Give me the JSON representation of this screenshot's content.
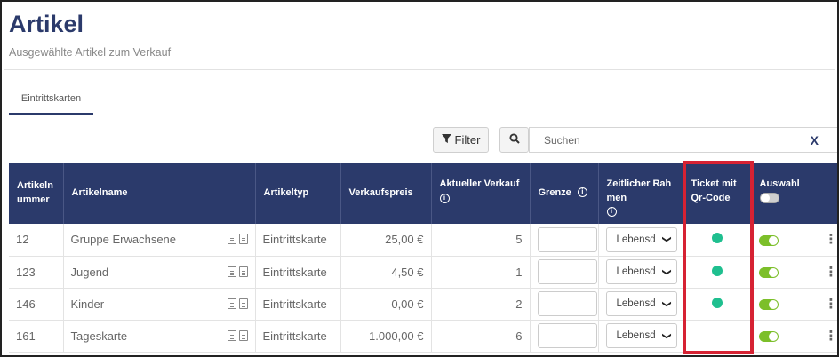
{
  "header": {
    "title": "Artikel",
    "subtitle": "Ausgewählte Artikel zum Verkauf"
  },
  "tabs": [
    {
      "label": "Eintrittskarten",
      "active": true
    }
  ],
  "toolbar": {
    "filter_label": "Filter",
    "search_placeholder": "Suchen",
    "clear_label": "X"
  },
  "table": {
    "columns": [
      {
        "label": "Artikeln ummer"
      },
      {
        "label": "Artikelname"
      },
      {
        "label": "Artikeltyp"
      },
      {
        "label": "Verkaufspreis"
      },
      {
        "label": "Aktueller Verkauf"
      },
      {
        "label": "Grenze"
      },
      {
        "label": "Zeitlicher Rah men"
      },
      {
        "label": "Ticket mit Qr-Code"
      },
      {
        "label": "Auswahl"
      }
    ],
    "rows": [
      {
        "nummer": "12",
        "name": "Gruppe Erwachsene",
        "typ": "Eintrittskarte",
        "preis": "25,00 €",
        "verkauf": "5",
        "grenze": "",
        "rahmen": "Lebensd",
        "qr": true,
        "auswahl": true
      },
      {
        "nummer": "123",
        "name": "Jugend",
        "typ": "Eintrittskarte",
        "preis": "4,50 €",
        "verkauf": "1",
        "grenze": "",
        "rahmen": "Lebensd",
        "qr": true,
        "auswahl": true
      },
      {
        "nummer": "146",
        "name": "Kinder",
        "typ": "Eintrittskarte",
        "preis": "0,00 €",
        "verkauf": "2",
        "grenze": "",
        "rahmen": "Lebensd",
        "qr": true,
        "auswahl": true
      },
      {
        "nummer": "161",
        "name": "Tageskarte",
        "typ": "Eintrittskarte",
        "preis": "1.000,00 €",
        "verkauf": "6",
        "grenze": "",
        "rahmen": "Lebensd",
        "qr": false,
        "auswahl": true
      }
    ]
  },
  "colors": {
    "header_bg": "#2b3a6b",
    "qr_dot": "#1fbf8f",
    "toggle_on": "#7cbf2a",
    "highlight": "#d62233"
  }
}
